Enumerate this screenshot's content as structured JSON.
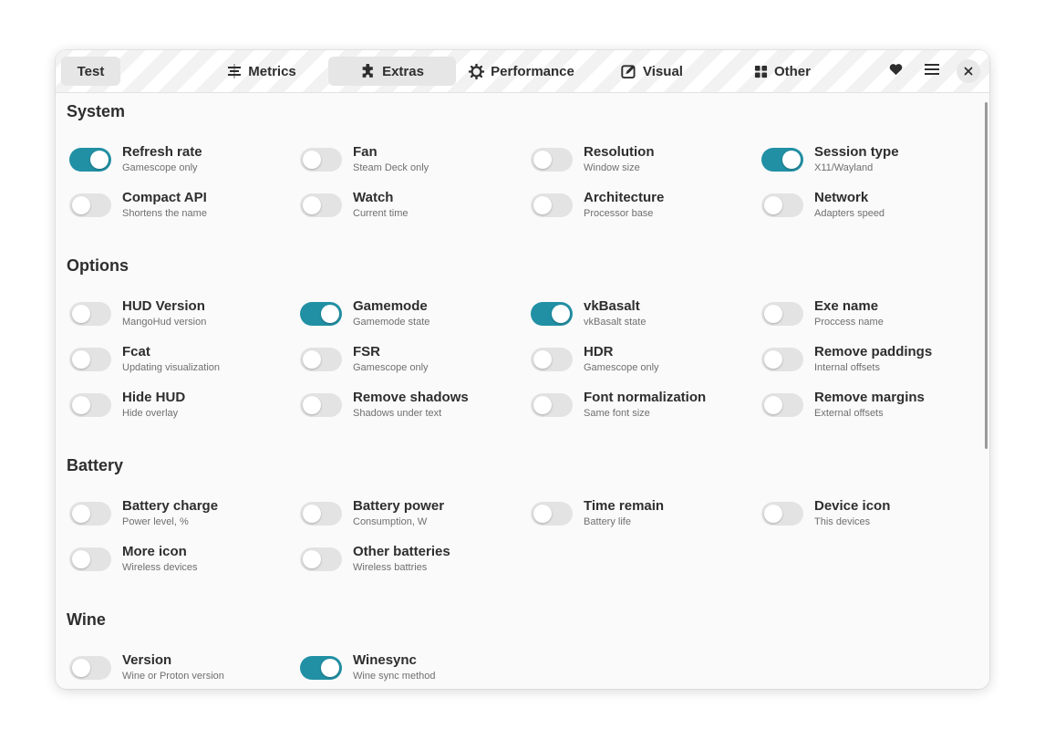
{
  "header": {
    "test_label": "Test",
    "tabs": [
      {
        "label": "Metrics",
        "icon": "metrics-icon"
      },
      {
        "label": "Extras",
        "icon": "puzzle-icon",
        "active": true
      },
      {
        "label": "Performance",
        "icon": "gear-icon"
      },
      {
        "label": "Visual",
        "icon": "visual-icon"
      },
      {
        "label": "Other",
        "icon": "grid-icon"
      }
    ],
    "heart_icon": "heart-icon",
    "menu_icon": "hamburger-menu-icon",
    "close_icon": "close-icon"
  },
  "colors": {
    "accent": "#2190a4",
    "switch_off": "#e3e3e3"
  },
  "sections": [
    {
      "title": "System",
      "items": [
        {
          "title": "Refresh rate",
          "subtitle": "Gamescope only",
          "on": true
        },
        {
          "title": "Fan",
          "subtitle": "Steam Deck only",
          "on": false
        },
        {
          "title": "Resolution",
          "subtitle": "Window size",
          "on": false
        },
        {
          "title": "Session type",
          "subtitle": "X11/Wayland",
          "on": true
        },
        {
          "title": "Compact API",
          "subtitle": "Shortens the name",
          "on": false
        },
        {
          "title": "Watch",
          "subtitle": "Current time",
          "on": false
        },
        {
          "title": "Architecture",
          "subtitle": "Processor base",
          "on": false
        },
        {
          "title": "Network",
          "subtitle": "Adapters speed",
          "on": false
        }
      ]
    },
    {
      "title": "Options",
      "items": [
        {
          "title": "HUD Version",
          "subtitle": "MangoHud version",
          "on": false
        },
        {
          "title": "Gamemode",
          "subtitle": "Gamemode state",
          "on": true
        },
        {
          "title": "vkBasalt",
          "subtitle": "vkBasalt state",
          "on": true
        },
        {
          "title": "Exe name",
          "subtitle": "Proccess name",
          "on": false
        },
        {
          "title": "Fcat",
          "subtitle": "Updating visualization",
          "on": false
        },
        {
          "title": "FSR",
          "subtitle": "Gamescope only",
          "on": false
        },
        {
          "title": "HDR",
          "subtitle": "Gamescope only",
          "on": false
        },
        {
          "title": "Remove paddings",
          "subtitle": "Internal offsets",
          "on": false
        },
        {
          "title": "Hide HUD",
          "subtitle": "Hide overlay",
          "on": false
        },
        {
          "title": "Remove shadows",
          "subtitle": "Shadows under text",
          "on": false
        },
        {
          "title": "Font normalization",
          "subtitle": "Same font size",
          "on": false
        },
        {
          "title": "Remove margins",
          "subtitle": "External offsets",
          "on": false
        }
      ]
    },
    {
      "title": "Battery",
      "items": [
        {
          "title": "Battery charge",
          "subtitle": "Power level, %",
          "on": false
        },
        {
          "title": "Battery power",
          "subtitle": "Consumption, W",
          "on": false
        },
        {
          "title": "Time remain",
          "subtitle": "Battery life",
          "on": false
        },
        {
          "title": "Device icon",
          "subtitle": "This devices",
          "on": false
        },
        {
          "title": "More icon",
          "subtitle": "Wireless devices",
          "on": false
        },
        {
          "title": "Other batteries",
          "subtitle": "Wireless battries",
          "on": false
        }
      ]
    },
    {
      "title": "Wine",
      "items": [
        {
          "title": "Version",
          "subtitle": "Wine or Proton version",
          "on": false
        },
        {
          "title": "Winesync",
          "subtitle": "Wine sync method",
          "on": true
        }
      ]
    }
  ]
}
